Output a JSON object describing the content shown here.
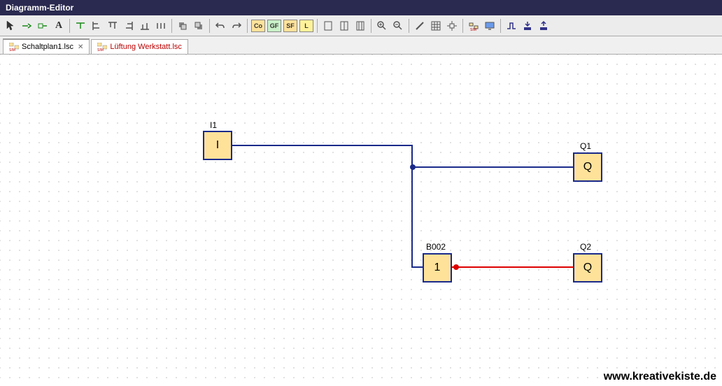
{
  "titlebar": {
    "title": "Diagramm-Editor"
  },
  "toolbar": {
    "letters": {
      "co": "Co",
      "gf": "GF",
      "sf": "SF",
      "l": "L"
    }
  },
  "tabs": [
    {
      "icon": "sim-icon",
      "label": "Schaltplan1.lsc",
      "active": true,
      "closable": true,
      "red": false
    },
    {
      "icon": "sim-icon",
      "label": "Lüftung Werkstatt.lsc",
      "active": false,
      "closable": false,
      "red": true
    }
  ],
  "blocks": {
    "i1": {
      "label": "I1",
      "content": "I"
    },
    "q1": {
      "label": "Q1",
      "content": "Q"
    },
    "b002": {
      "label": "B002",
      "content": "1"
    },
    "q2": {
      "label": "Q2",
      "content": "Q"
    }
  },
  "watermark": "www.kreativekiste.de"
}
